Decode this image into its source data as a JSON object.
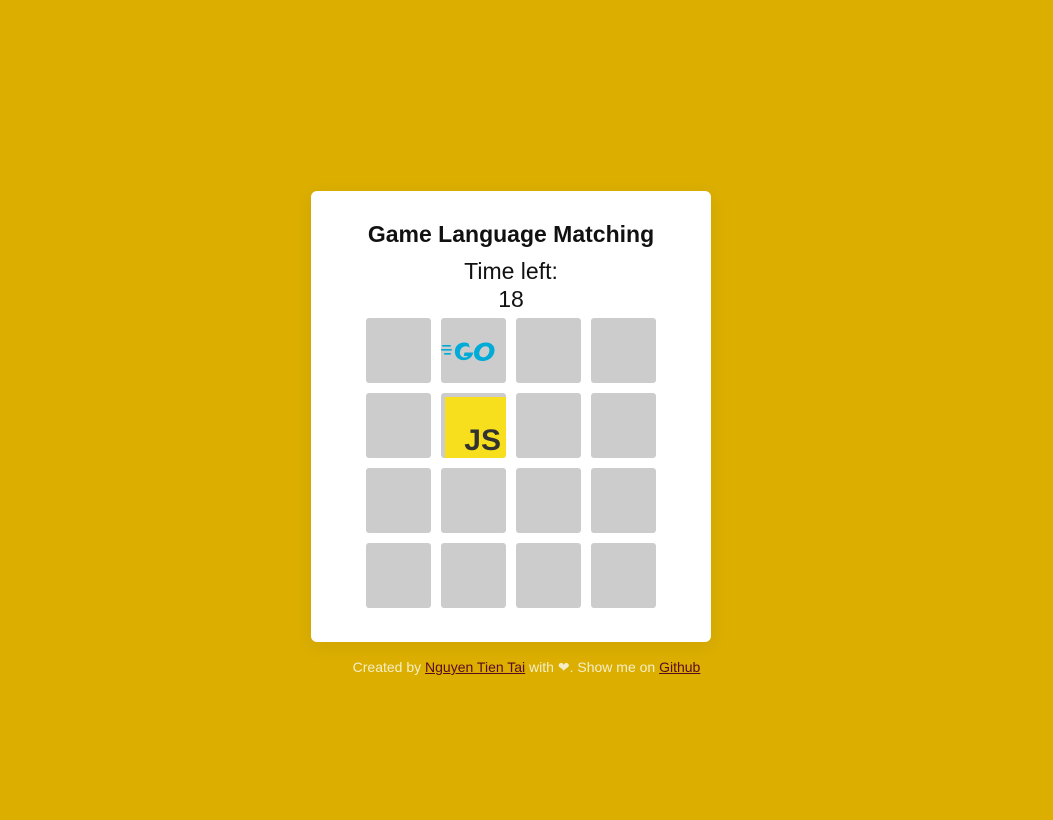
{
  "game": {
    "title": "Game Language Matching",
    "timer_label": "Time left:",
    "timer_value": "18"
  },
  "tiles": [
    {
      "state": "hidden"
    },
    {
      "state": "revealed",
      "language": "Go",
      "icon": "go-logo-icon"
    },
    {
      "state": "hidden"
    },
    {
      "state": "hidden"
    },
    {
      "state": "hidden"
    },
    {
      "state": "revealed",
      "language": "JavaScript",
      "icon": "js-logo-icon",
      "text": "JS"
    },
    {
      "state": "hidden"
    },
    {
      "state": "hidden"
    },
    {
      "state": "hidden"
    },
    {
      "state": "hidden"
    },
    {
      "state": "hidden"
    },
    {
      "state": "hidden"
    },
    {
      "state": "hidden"
    },
    {
      "state": "hidden"
    },
    {
      "state": "hidden"
    },
    {
      "state": "hidden"
    }
  ],
  "footer": {
    "prefix": "Created by ",
    "author_link": "Nguyen Tien Tai",
    "middle": " with ",
    "heart": "❤",
    "middle2": ". Show me on ",
    "github_link": "Github"
  },
  "colors": {
    "background": "#dbae00",
    "tile_hidden": "#cccccc",
    "go_blue": "#00acd7",
    "js_yellow": "#f7df1e",
    "link": "#5a0a1e"
  }
}
